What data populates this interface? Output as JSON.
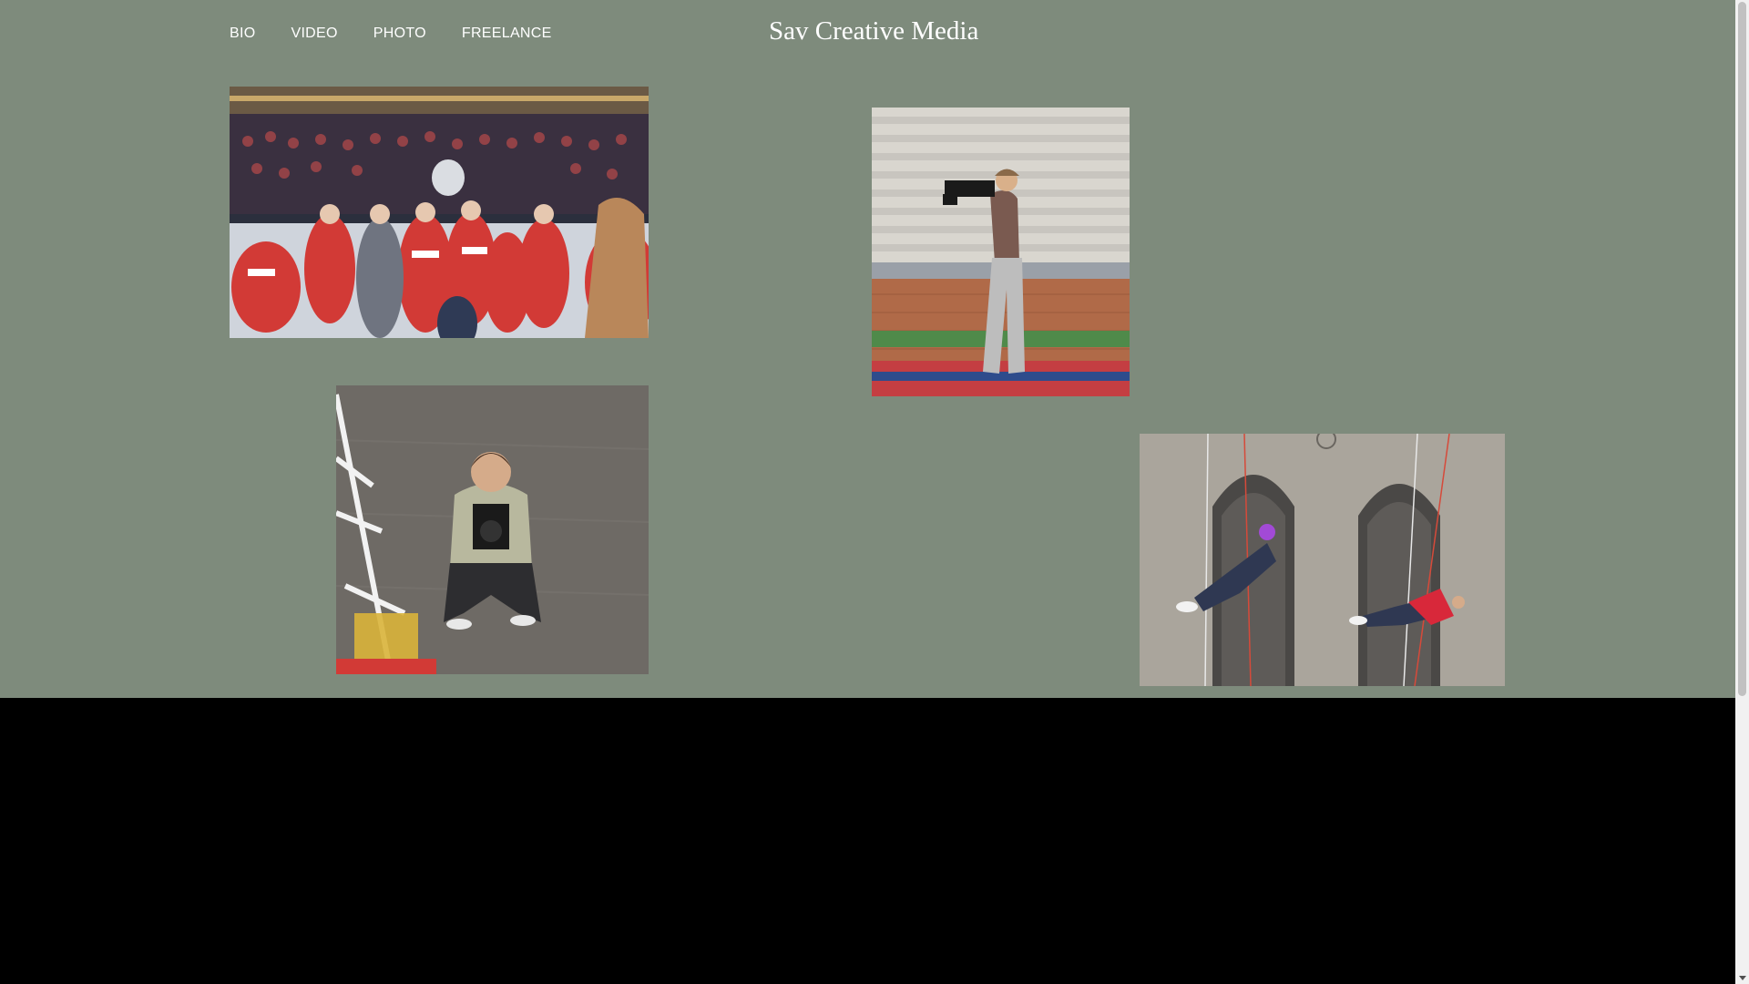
{
  "nav": {
    "items": [
      {
        "label": "BIO"
      },
      {
        "label": "VIDEO"
      },
      {
        "label": "PHOTO"
      },
      {
        "label": "FREELANCE"
      }
    ]
  },
  "site": {
    "title": "Sav Creative Media"
  },
  "colors": {
    "hero_background": "#7e8b7c",
    "footer_background": "#000000",
    "text": "#ffffff"
  },
  "gallery": [
    {
      "name": "hockey-celebration-photo"
    },
    {
      "name": "stadium-videographer-photo"
    },
    {
      "name": "photographer-crouching-photo"
    },
    {
      "name": "rappelling-photo"
    }
  ]
}
